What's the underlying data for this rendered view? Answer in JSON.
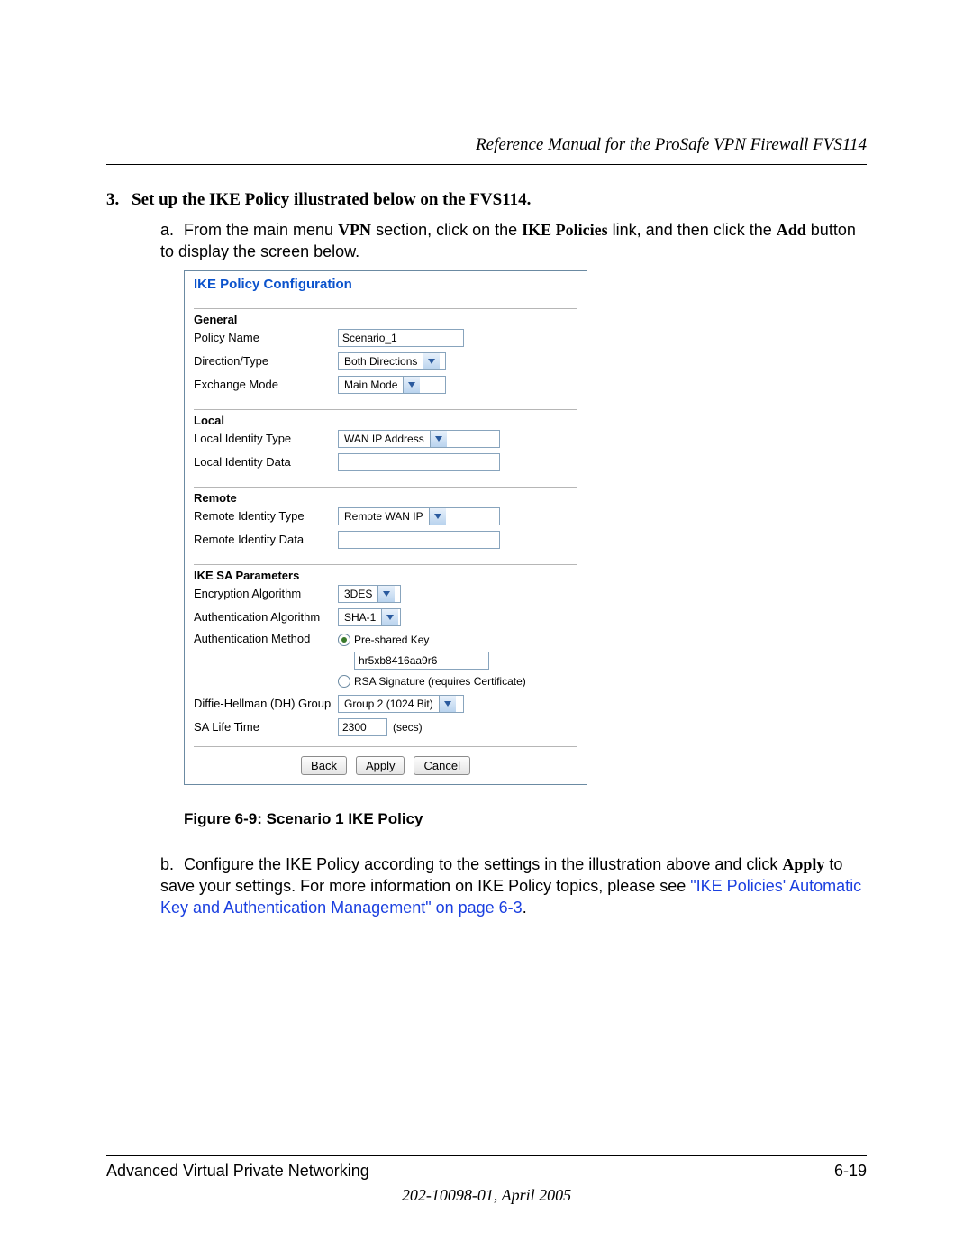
{
  "header": {
    "title": "Reference Manual for the ProSafe VPN Firewall FVS114"
  },
  "step": {
    "number": "3.",
    "title": "Set up the IKE Policy illustrated below on the FVS114.",
    "a": {
      "marker": "a.",
      "pre": "From the main menu ",
      "vpn": "VPN",
      "mid1": " section, click on the ",
      "ike": "IKE Policies",
      "mid2": " link, and then click the ",
      "add": "Add",
      "post": " button to display the screen below."
    },
    "b": {
      "marker": "b.",
      "t1": "Configure the IKE Policy according to the settings in the illustration above and click ",
      "apply": "Apply",
      "t2": " to save your settings. For more information on IKE Policy topics, please see ",
      "linkA": "\"IKE Policies' Automatic Key and Authentication Management\" on page 6-3",
      "period": "."
    }
  },
  "panel": {
    "title": "IKE Policy Configuration",
    "general": {
      "head": "General",
      "policy_name_label": "Policy Name",
      "policy_name_value": "Scenario_1",
      "direction_label": "Direction/Type",
      "direction_value": "Both Directions",
      "exchange_label": "Exchange Mode",
      "exchange_value": "Main Mode"
    },
    "local": {
      "head": "Local",
      "id_type_label": "Local Identity Type",
      "id_type_value": "WAN IP Address",
      "id_data_label": "Local Identity Data",
      "id_data_value": ""
    },
    "remote": {
      "head": "Remote",
      "id_type_label": "Remote Identity Type",
      "id_type_value": "Remote WAN IP",
      "id_data_label": "Remote Identity Data",
      "id_data_value": ""
    },
    "sa": {
      "head": "IKE SA Parameters",
      "enc_label": "Encryption Algorithm",
      "enc_value": "3DES",
      "auth_alg_label": "Authentication Algorithm",
      "auth_alg_value": "SHA-1",
      "auth_method_label": "Authentication Method",
      "psk_label": "Pre-shared Key",
      "psk_value": "hr5xb8416aa9r6",
      "rsa_label": "RSA Signature (requires Certificate)",
      "dh_label": "Diffie-Hellman (DH) Group",
      "dh_value": "Group 2 (1024 Bit)",
      "life_label": "SA Life Time",
      "life_value": "2300",
      "life_unit": "(secs)"
    },
    "buttons": {
      "back": "Back",
      "apply": "Apply",
      "cancel": "Cancel"
    }
  },
  "figure_caption": "Figure 6-9: Scenario 1 IKE Policy",
  "footer": {
    "chapter": "Advanced Virtual Private Networking",
    "page": "6-19",
    "docid": "202-10098-01, April 2005"
  }
}
